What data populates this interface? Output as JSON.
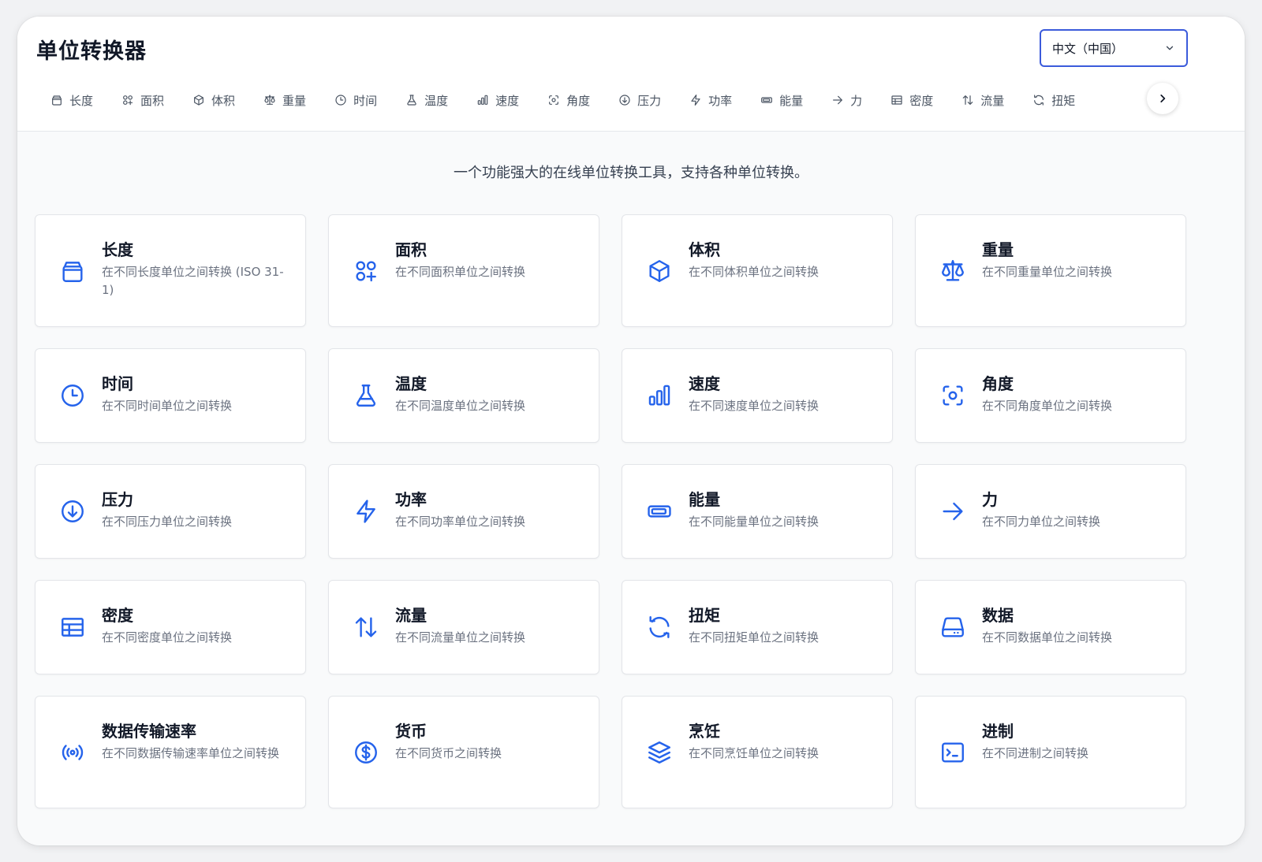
{
  "app": {
    "title": "单位转换器"
  },
  "language": {
    "selected": "中文（中国）"
  },
  "nav": {
    "items": [
      {
        "label": "长度",
        "icon": "length-icon"
      },
      {
        "label": "面积",
        "icon": "area-icon"
      },
      {
        "label": "体积",
        "icon": "volume-icon"
      },
      {
        "label": "重量",
        "icon": "weight-icon"
      },
      {
        "label": "时间",
        "icon": "time-icon"
      },
      {
        "label": "温度",
        "icon": "temperature-icon"
      },
      {
        "label": "速度",
        "icon": "speed-icon"
      },
      {
        "label": "角度",
        "icon": "angle-icon"
      },
      {
        "label": "压力",
        "icon": "pressure-icon"
      },
      {
        "label": "功率",
        "icon": "power-icon"
      },
      {
        "label": "能量",
        "icon": "energy-icon"
      },
      {
        "label": "力",
        "icon": "force-icon"
      },
      {
        "label": "密度",
        "icon": "density-icon"
      },
      {
        "label": "流量",
        "icon": "flow-icon"
      },
      {
        "label": "扭矩",
        "icon": "torque-icon"
      }
    ]
  },
  "tagline": "一个功能强大的在线单位转换工具，支持各种单位转换。",
  "accent_color": "#2563eb",
  "cards": [
    {
      "title": "长度",
      "desc": "在不同长度单位之间转换 (ISO 31-1)",
      "icon": "length-icon"
    },
    {
      "title": "面积",
      "desc": "在不同面积单位之间转换",
      "icon": "area-icon"
    },
    {
      "title": "体积",
      "desc": "在不同体积单位之间转换",
      "icon": "volume-icon"
    },
    {
      "title": "重量",
      "desc": "在不同重量单位之间转换",
      "icon": "weight-icon"
    },
    {
      "title": "时间",
      "desc": "在不同时间单位之间转换",
      "icon": "time-icon"
    },
    {
      "title": "温度",
      "desc": "在不同温度单位之间转换",
      "icon": "temperature-icon"
    },
    {
      "title": "速度",
      "desc": "在不同速度单位之间转换",
      "icon": "speed-icon"
    },
    {
      "title": "角度",
      "desc": "在不同角度单位之间转换",
      "icon": "angle-icon"
    },
    {
      "title": "压力",
      "desc": "在不同压力单位之间转换",
      "icon": "pressure-icon"
    },
    {
      "title": "功率",
      "desc": "在不同功率单位之间转换",
      "icon": "power-icon"
    },
    {
      "title": "能量",
      "desc": "在不同能量单位之间转换",
      "icon": "energy-icon"
    },
    {
      "title": "力",
      "desc": "在不同力单位之间转换",
      "icon": "force-icon"
    },
    {
      "title": "密度",
      "desc": "在不同密度单位之间转换",
      "icon": "density-icon"
    },
    {
      "title": "流量",
      "desc": "在不同流量单位之间转换",
      "icon": "flow-icon"
    },
    {
      "title": "扭矩",
      "desc": "在不同扭矩单位之间转换",
      "icon": "torque-icon"
    },
    {
      "title": "数据",
      "desc": "在不同数据单位之间转换",
      "icon": "data-icon"
    },
    {
      "title": "数据传输速率",
      "desc": "在不同数据传输速率单位之间转换",
      "icon": "data-rate-icon"
    },
    {
      "title": "货币",
      "desc": "在不同货币之间转换",
      "icon": "currency-icon"
    },
    {
      "title": "烹饪",
      "desc": "在不同烹饪单位之间转换",
      "icon": "cooking-icon"
    },
    {
      "title": "进制",
      "desc": "在不同进制之间转换",
      "icon": "number-base-icon"
    }
  ]
}
